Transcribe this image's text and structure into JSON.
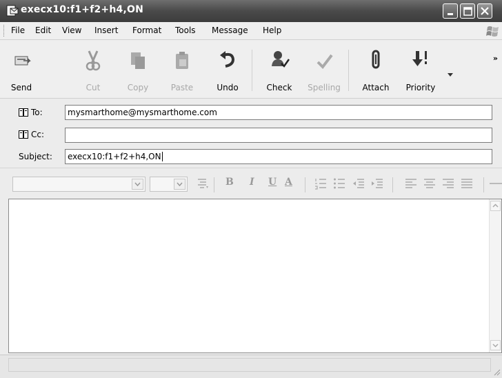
{
  "window": {
    "title": "execx10:f1+f2+h4,ON"
  },
  "menu": [
    "File",
    "Edit",
    "View",
    "Insert",
    "Format",
    "Tools",
    "Message",
    "Help"
  ],
  "toolbar": {
    "send": "Send",
    "cut": "Cut",
    "copy": "Copy",
    "paste": "Paste",
    "undo": "Undo",
    "check": "Check",
    "spelling": "Spelling",
    "attach": "Attach",
    "priority": "Priority",
    "more": "»"
  },
  "fields": {
    "to_label": "To:",
    "to_value": "mysmarthome@mysmarthome.com",
    "cc_label": "Cc:",
    "cc_value": "",
    "subject_label": "Subject:",
    "subject_value": "execx10:f1+f2+h4,ON"
  },
  "format": {
    "bold": "B",
    "italic": "I",
    "underline": "U",
    "font_color": "A"
  },
  "body": {
    "text": ""
  }
}
